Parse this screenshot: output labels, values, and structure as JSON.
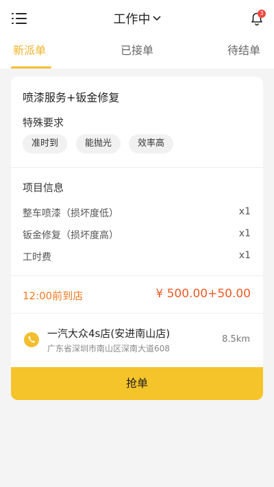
{
  "header": {
    "status_title": "工作中",
    "notification_count": "3"
  },
  "tabs": [
    {
      "label": "新派单",
      "active": true
    },
    {
      "label": "已接单",
      "active": false
    },
    {
      "label": "待结单",
      "active": false
    }
  ],
  "order": {
    "service_title": "喷漆服务+钣金修复",
    "requirements_label": "特殊要求",
    "requirements": [
      "准时到",
      "能抛光",
      "效率高"
    ],
    "project_label": "项目信息",
    "items": [
      {
        "name": "整车喷漆（损坏度低）",
        "qty": "x1"
      },
      {
        "name": "钣金修复（损坏度高）",
        "qty": "x1"
      },
      {
        "name": "工时费",
        "qty": "x1"
      }
    ],
    "arrival_time": "12:00前到店",
    "price": "¥ 500.00+50.00",
    "shop": {
      "name": "一汽大众4s店(安进南山店)",
      "address": "广东省深圳市南山区深南大道608",
      "distance": "8.5km"
    },
    "action_label": "抢单"
  },
  "colors": {
    "accent": "#f2be2d",
    "price": "#ee5a24",
    "arrival": "#f07a22",
    "badge": "#f0483e"
  },
  "icons": [
    "menu-icon",
    "chevron-down-icon",
    "bell-icon",
    "phone-icon"
  ]
}
